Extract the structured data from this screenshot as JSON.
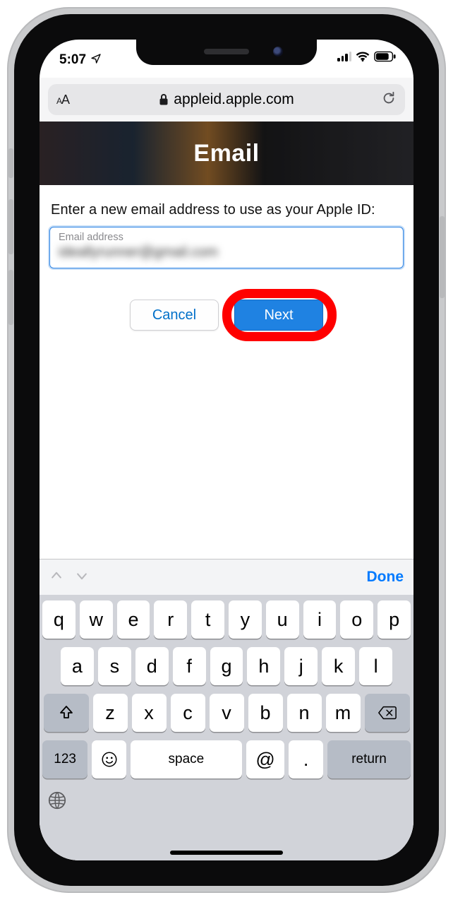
{
  "status": {
    "time": "5:07"
  },
  "browser": {
    "url": "appleid.apple.com"
  },
  "page": {
    "header_title": "Email",
    "prompt": "Enter a new email address to use as your Apple ID:",
    "email_field_label": "Email address",
    "email_field_value": "ideallyrunner@gmail.com",
    "cancel_label": "Cancel",
    "next_label": "Next"
  },
  "keyboard": {
    "done_label": "Done",
    "row1": [
      "q",
      "w",
      "e",
      "r",
      "t",
      "y",
      "u",
      "i",
      "o",
      "p"
    ],
    "row2": [
      "a",
      "s",
      "d",
      "f",
      "g",
      "h",
      "j",
      "k",
      "l"
    ],
    "row3": [
      "z",
      "x",
      "c",
      "v",
      "b",
      "n",
      "m"
    ],
    "numbers_label": "123",
    "space_label": "space",
    "at_label": "@",
    "dot_label": ".",
    "return_label": "return"
  }
}
